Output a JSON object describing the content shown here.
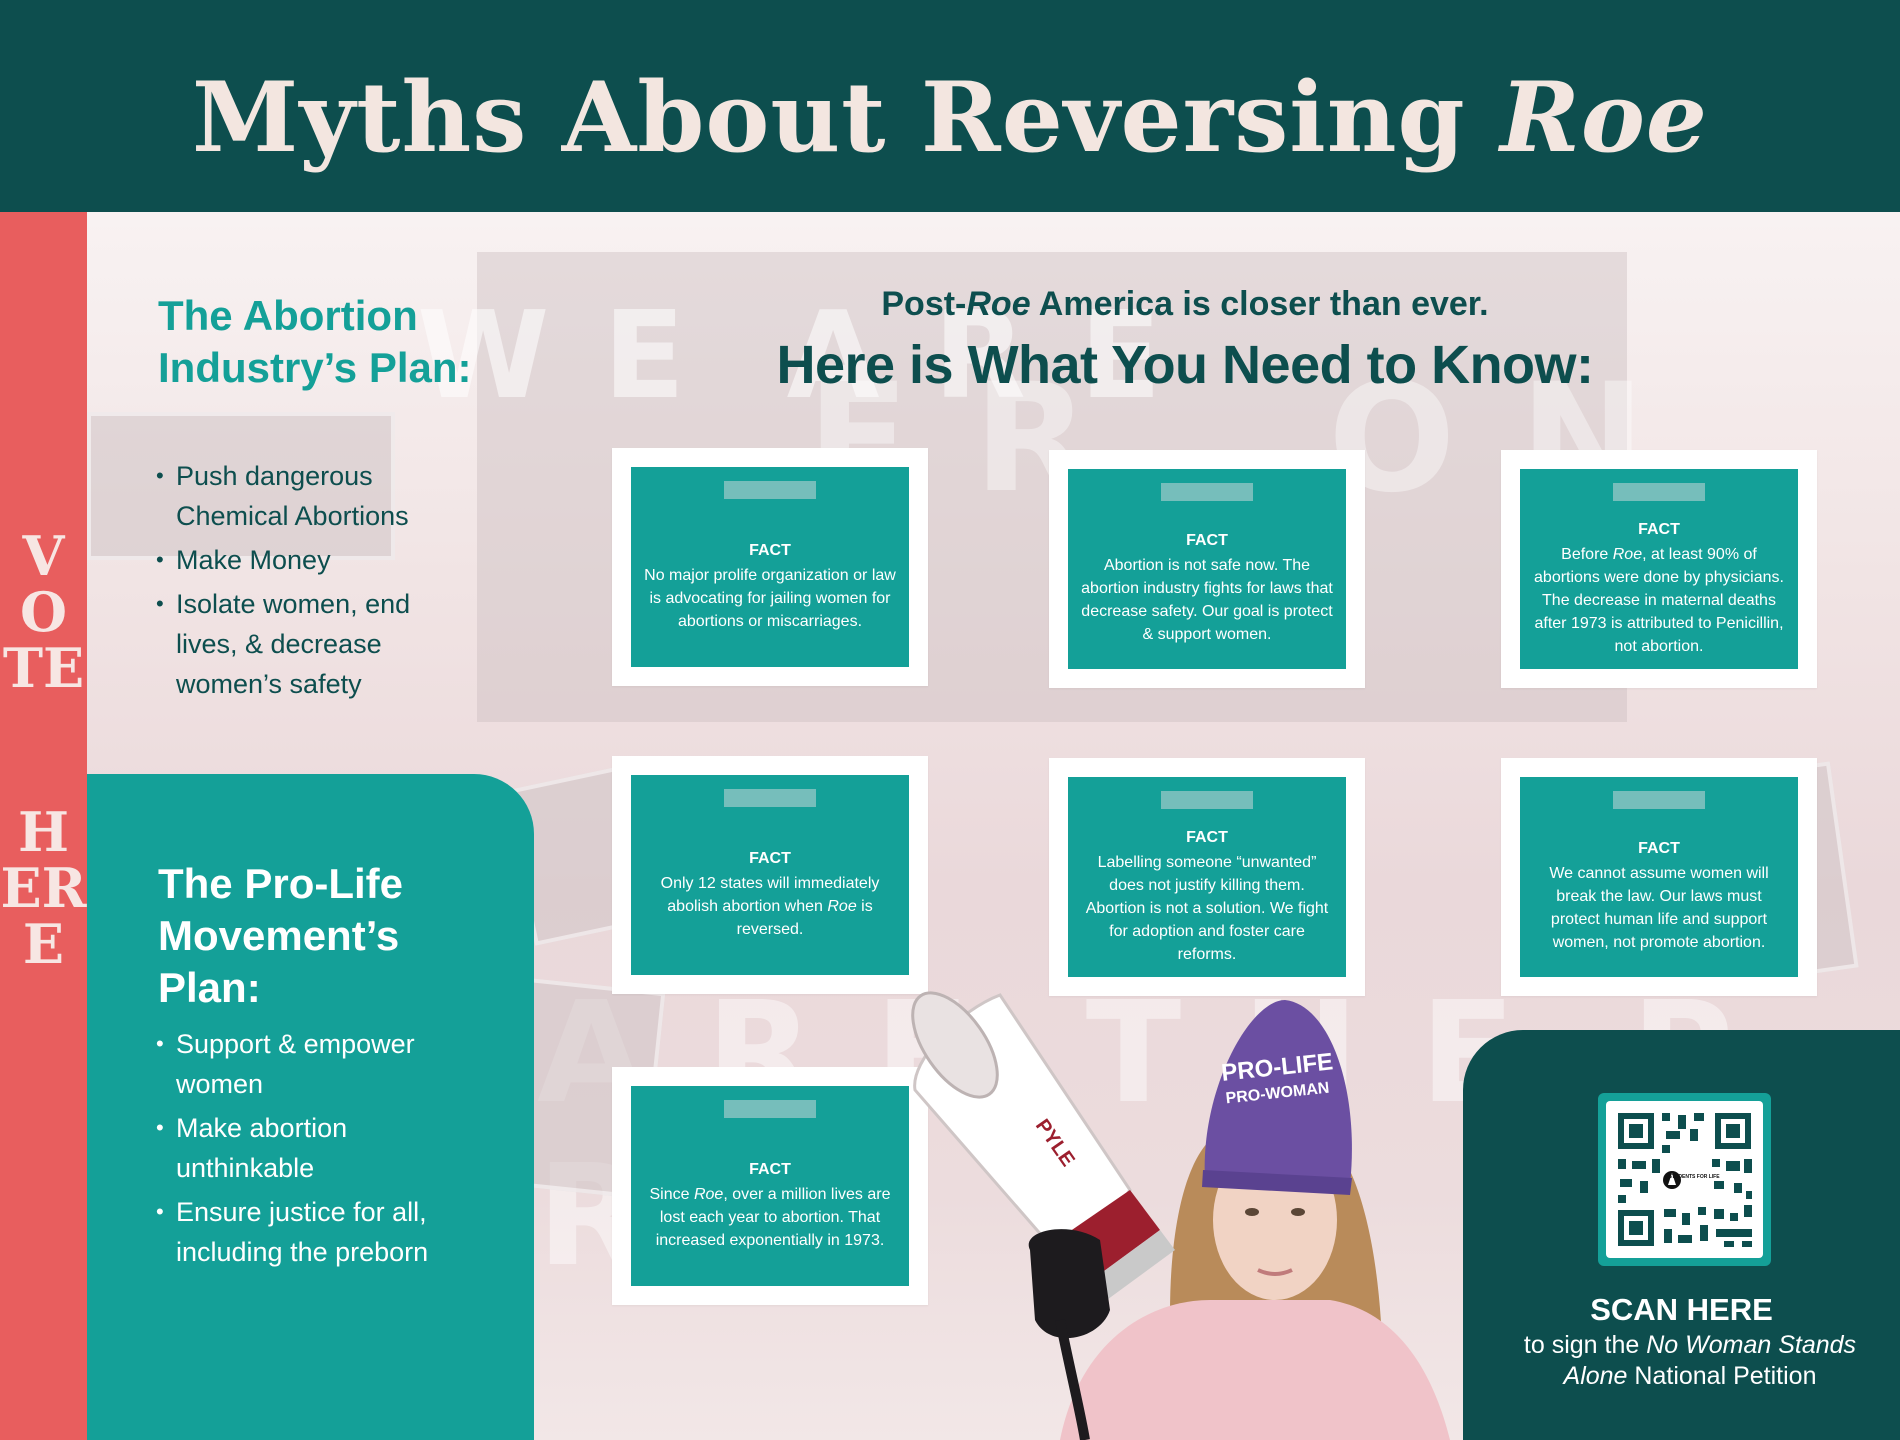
{
  "header": {
    "title": "Myths About Reversing",
    "title_italic": "Roe"
  },
  "sidebar": {
    "vote": "VOTE",
    "here": "HERE"
  },
  "industry_plan": {
    "title": "The Abortion Industry’s Plan:",
    "items": [
      "Push dangerous Chemical Abortions",
      "Make Money",
      "Isolate women, end lives, & decrease women’s safety"
    ]
  },
  "prolife_plan": {
    "title": "The Pro-Life Movement’s Plan:",
    "items": [
      "Support & empower women",
      "Make abortion unthinkable",
      "Ensure justice for all, including the preborn"
    ]
  },
  "headings": {
    "sub_before": "Post-",
    "sub_italic": "Roe",
    "sub_after": " America is closer than ever.",
    "main": "Here is What You Need to Know:"
  },
  "facts": [
    {
      "label": "FACT",
      "parts": [
        "No major prolife organization or law is advocating for jailing women for abortions or miscarriages."
      ]
    },
    {
      "label": "FACT",
      "parts": [
        "Abortion is not safe now. The abortion industry fights for laws that decrease safety. Our goal is protect & support women."
      ]
    },
    {
      "label": "FACT",
      "parts": [
        "Before ",
        "Roe",
        ", at least 90% of abortions were done by physicians. The decrease in maternal deaths after 1973 is attributed to Penicillin, not abortion."
      ]
    },
    {
      "label": "FACT",
      "parts": [
        "Only 12 states will immediately abolish abortion when ",
        "Roe",
        " is reversed."
      ]
    },
    {
      "label": "FACT",
      "parts": [
        "Labelling someone “unwanted” does not justify killing them. Abortion is not a solution. We fight for adoption and foster care reforms."
      ]
    },
    {
      "label": "FACT",
      "parts": [
        "We cannot assume women will break the law. Our laws must protect human life and support women, not promote abortion."
      ]
    },
    {
      "label": "FACT",
      "parts": [
        "Since ",
        "Roe",
        ", over a million lives are lost each year to abortion. That increased exponentially in 1973."
      ]
    }
  ],
  "photo": {
    "hat_line1": "PRO-LIFE",
    "hat_line2": "PRO-WOMAN",
    "megaphone_brand": "PYLE"
  },
  "qr": {
    "logo_text": "STUDENTS FOR LIFE",
    "heading": "SCAN HERE",
    "text_before": "to sign the ",
    "text_italic": "No Woman Stands Alone",
    "text_after": " National Petition"
  },
  "colors": {
    "dark_teal": "#0d4e4e",
    "teal": "#14a098",
    "coral": "#e85e5e",
    "cream": "#f3e6e0"
  }
}
